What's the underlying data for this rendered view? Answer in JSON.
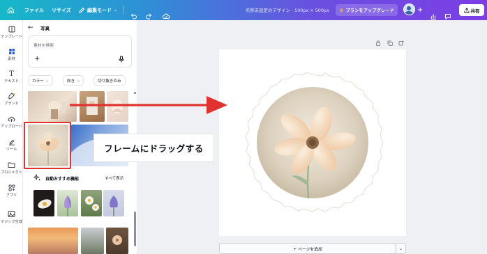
{
  "topbar": {
    "file": "ファイル",
    "resize": "リサイズ",
    "edit_mode": "編集モード",
    "doc_title": "名称未設定のデザイン - 500px × 500px",
    "upgrade": "プランをアップグレード",
    "share": "共有"
  },
  "rail": {
    "items": [
      "テンプレート",
      "素材",
      "テキスト",
      "ブランド",
      "アップロード",
      "ツール",
      "プロジェクト",
      "アプリ",
      "マジック生成"
    ]
  },
  "panel": {
    "title": "写真",
    "search_placeholder": "素材を検索",
    "filters": [
      "カラー",
      "向き",
      "切り抜きのみ"
    ],
    "featured_title": "自動おすすめ機能",
    "featured_all": "すべて表示"
  },
  "canvas": {
    "add_page": "+ ページを追加"
  },
  "callout": {
    "text": "フレームにドラッグする"
  },
  "colors": {
    "accent_red": "#e0332f",
    "topbar_gradient_start": "#16b8c8",
    "topbar_gradient_end": "#7a3ee4"
  }
}
